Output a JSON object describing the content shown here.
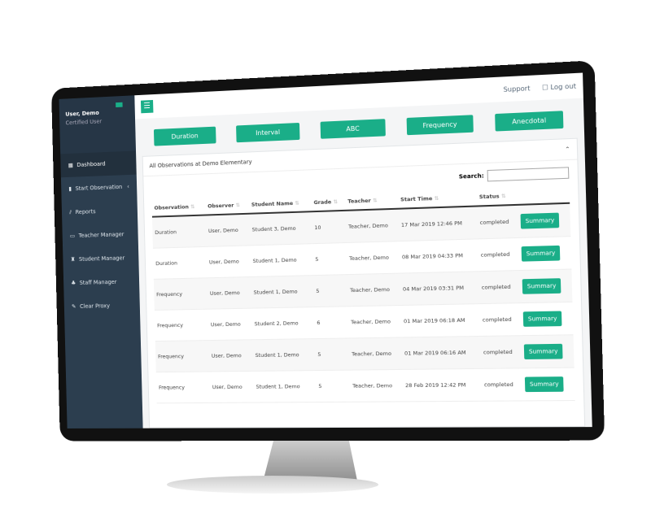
{
  "topbar": {
    "support": "Support",
    "logout": "Log out"
  },
  "user": {
    "name": "User, Demo",
    "role": "Certified User"
  },
  "sidebar": [
    {
      "label": "Dashboard",
      "icon": "grid-icon"
    },
    {
      "label": "Start Observation",
      "icon": "clipboard-icon"
    },
    {
      "label": "Reports",
      "icon": "chart-icon"
    },
    {
      "label": "Teacher Manager",
      "icon": "chalkboard-icon"
    },
    {
      "label": "Student Manager",
      "icon": "student-icon"
    },
    {
      "label": "Staff Manager",
      "icon": "users-icon"
    },
    {
      "label": "Clear Proxy",
      "icon": "brush-icon"
    }
  ],
  "types": [
    "Duration",
    "Interval",
    "ABC",
    "Frequency",
    "Anecdotal"
  ],
  "panel_title": "All Observations at Demo Elementary",
  "search_label": "Search:",
  "columns": [
    "Observation",
    "Observer",
    "Student Name",
    "Grade",
    "Teacher",
    "Start Time",
    "Status",
    ""
  ],
  "rows": [
    [
      "Duration",
      "User, Demo",
      "Student 3, Demo",
      "10",
      "Teacher, Demo",
      "17 Mar 2019 12:46 PM",
      "completed"
    ],
    [
      "Duration",
      "User, Demo",
      "Student 1, Demo",
      "5",
      "Teacher, Demo",
      "08 Mar 2019 04:33 PM",
      "completed"
    ],
    [
      "Frequency",
      "User, Demo",
      "Student 1, Demo",
      "5",
      "Teacher, Demo",
      "04 Mar 2019 03:31 PM",
      "completed"
    ],
    [
      "Frequency",
      "User, Demo",
      "Student 2, Demo",
      "6",
      "Teacher, Demo",
      "01 Mar 2019 06:18 AM",
      "completed"
    ],
    [
      "Frequency",
      "User, Demo",
      "Student 1, Demo",
      "5",
      "Teacher, Demo",
      "01 Mar 2019 06:16 AM",
      "completed"
    ],
    [
      "Frequency",
      "User, Demo",
      "Student 1, Demo",
      "5",
      "Teacher, Demo",
      "28 Feb 2019 12:42 PM",
      "completed"
    ]
  ],
  "summary_label": "Summary",
  "accent": "#1aae88"
}
